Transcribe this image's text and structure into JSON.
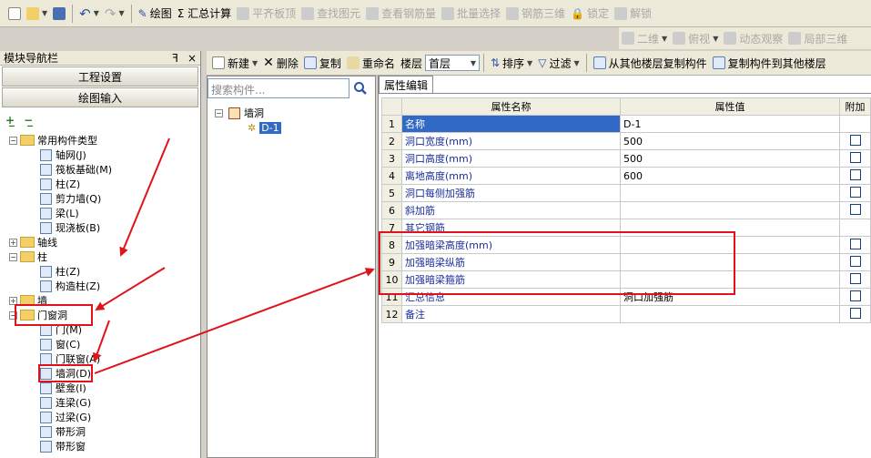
{
  "toolbar": {
    "draw": "绘图",
    "sum": "Σ 汇总计算",
    "flat_slab": "平齐板顶",
    "find_elem": "查找图元",
    "view_rebar": "查看钢筋量",
    "batch_select": "批量选择",
    "rebar_3d": "钢筋三维",
    "lock": "锁定",
    "unlock": "解锁"
  },
  "view_toolbar": {
    "two_d": "二维",
    "top_view": "俯视",
    "dynamic_view": "动态观察",
    "local_3d": "局部三维"
  },
  "nav": {
    "title": "模块导航栏",
    "pin": "ꟻ",
    "close": "×",
    "project_settings": "工程设置",
    "drawing_input": "绘图输入",
    "tree": [
      {
        "label": "常用构件类型",
        "level": 0,
        "type": "folder",
        "exp": "−"
      },
      {
        "label": "轴网(J)",
        "level": 1,
        "type": "item"
      },
      {
        "label": "筏板基础(M)",
        "level": 1,
        "type": "item"
      },
      {
        "label": "柱(Z)",
        "level": 1,
        "type": "item"
      },
      {
        "label": "剪力墙(Q)",
        "level": 1,
        "type": "item"
      },
      {
        "label": "梁(L)",
        "level": 1,
        "type": "item"
      },
      {
        "label": "现浇板(B)",
        "level": 1,
        "type": "item"
      },
      {
        "label": "轴线",
        "level": 0,
        "type": "folder",
        "exp": "+"
      },
      {
        "label": "柱",
        "level": 0,
        "type": "folder",
        "exp": "−"
      },
      {
        "label": "柱(Z)",
        "level": 1,
        "type": "item"
      },
      {
        "label": "构造柱(Z)",
        "level": 1,
        "type": "item"
      },
      {
        "label": "墙",
        "level": 0,
        "type": "folder",
        "exp": "+"
      },
      {
        "label": "门窗洞",
        "level": 0,
        "type": "folder",
        "exp": "−"
      },
      {
        "label": "门(M)",
        "level": 1,
        "type": "item"
      },
      {
        "label": "窗(C)",
        "level": 1,
        "type": "item"
      },
      {
        "label": "门联窗(A)",
        "level": 1,
        "type": "item"
      },
      {
        "label": "墙洞(D)",
        "level": 1,
        "type": "item"
      },
      {
        "label": "壁龛(I)",
        "level": 1,
        "type": "item"
      },
      {
        "label": "连梁(G)",
        "level": 1,
        "type": "item"
      },
      {
        "label": "过梁(G)",
        "level": 1,
        "type": "item"
      },
      {
        "label": "带形洞",
        "level": 1,
        "type": "item"
      },
      {
        "label": "带形窗",
        "level": 1,
        "type": "item"
      }
    ]
  },
  "component_toolbar": {
    "new": "新建",
    "delete": "删除",
    "copy": "复制",
    "rename": "重命名",
    "floor_label": "楼层",
    "floor_value": "首层",
    "sort": "排序",
    "filter": "过滤",
    "copy_from_other": "从其他楼层复制构件",
    "copy_to_other": "复制构件到其他楼层"
  },
  "component_list": {
    "search_placeholder": "搜索构件...",
    "root": "墙洞",
    "child": "D-1"
  },
  "props": {
    "tab": "属性编辑",
    "col_name": "属性名称",
    "col_value": "属性值",
    "col_extra": "附加",
    "rows": [
      {
        "n": "1",
        "name": "名称",
        "value": "D-1",
        "check": false,
        "selected": true
      },
      {
        "n": "2",
        "name": "洞口宽度(mm)",
        "value": "500",
        "check": true
      },
      {
        "n": "3",
        "name": "洞口高度(mm)",
        "value": "500",
        "check": true
      },
      {
        "n": "4",
        "name": "离地高度(mm)",
        "value": "600",
        "check": true
      },
      {
        "n": "5",
        "name": "洞口每侧加强筋",
        "value": "",
        "check": true
      },
      {
        "n": "6",
        "name": "斜加筋",
        "value": "",
        "check": true
      },
      {
        "n": "7",
        "name": "其它钢筋",
        "value": "",
        "check": false
      },
      {
        "n": "8",
        "name": "加强暗梁高度(mm)",
        "value": "",
        "check": true
      },
      {
        "n": "9",
        "name": "加强暗梁纵筋",
        "value": "",
        "check": true
      },
      {
        "n": "10",
        "name": "加强暗梁箍筋",
        "value": "",
        "check": true
      },
      {
        "n": "11",
        "name": "汇总信息",
        "value": "洞口加强筋",
        "check": true
      },
      {
        "n": "12",
        "name": "备注",
        "value": "",
        "check": true
      }
    ]
  },
  "colors": {
    "annotation_red": "#e0121b",
    "selection_blue": "#316ac5",
    "header_yellow": "#fbe39a"
  }
}
